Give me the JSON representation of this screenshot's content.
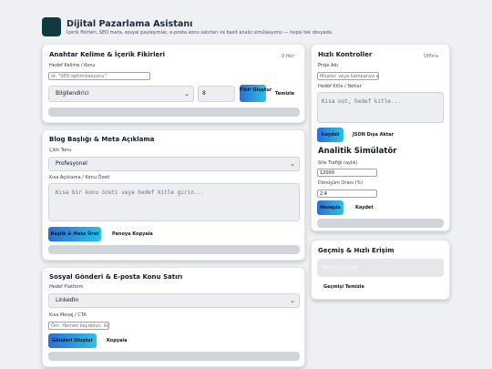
{
  "header": {
    "title": "Dijital Pazarlama Asistanı",
    "subtitle": "İçerik fikirleri, SEO meta, sosyal paylaşımlar, e-posta konu satırları ve basit analiz simülasyonu — hepsi tek dosyada."
  },
  "keywords": {
    "title": "Anahtar Kelime & İçerik Fikirleri",
    "count": "0 fikir",
    "topic_label": "Hedef Kelime / Konu",
    "topic_placeholder": "ör. \"SEO optimizasyonu\"",
    "goal_value": "Bilgilendirici",
    "number_value": "8",
    "generate_label": "Fikir Oluştur",
    "clear_label": "Temizle"
  },
  "blog": {
    "title": "Blog Başlığı & Meta Açıklama",
    "tone_label": "Çıktı Tonu",
    "tone_value": "Profesyonel",
    "summary_label": "Kısa Açıklama / Konu Özeti",
    "summary_placeholder": "Kısa bir konu özeti veya hedef kitle girin...",
    "generate_label": "Başlık & Meta Üret",
    "copy_label": "Panoya Kopyala"
  },
  "social": {
    "title": "Sosyal Gönderi & E-posta Konu Satırı",
    "platform_label": "Hedef Platform",
    "platform_value": "LinkedIn",
    "cta_label": "Kısa Mesaj / CTA",
    "cta_placeholder": "Örn. Hemen kaydolun, ilk",
    "generate_label": "Gönderi Oluştur",
    "copy_label": "Kopyala"
  },
  "controls": {
    "title": "Hızlı Kontroller",
    "status": "Offline",
    "project_label": "Proje Adı",
    "project_placeholder": "Müşteri veya kampanya a",
    "notes_label": "Hedef Kitle / Notlar",
    "notes_placeholder": "Kısa not, hedef kitle...",
    "save_label": "Kaydet",
    "export_label": "JSON Dışa Aktar"
  },
  "analytics": {
    "title": "Analitik Simülatör",
    "traffic_label": "Site Trafiği (aylık)",
    "traffic_value": "12000",
    "conversion_label": "Dönüşüm Oranı (%)",
    "conversion_value": "2.4",
    "calculate_label": "Hesapla",
    "save_label": "Kaydet"
  },
  "history": {
    "title": "Geçmiş & Hızlı Erişim",
    "empty_text": "Henüz kayıt yok",
    "clear_label": "Geçmişi Temizle"
  }
}
